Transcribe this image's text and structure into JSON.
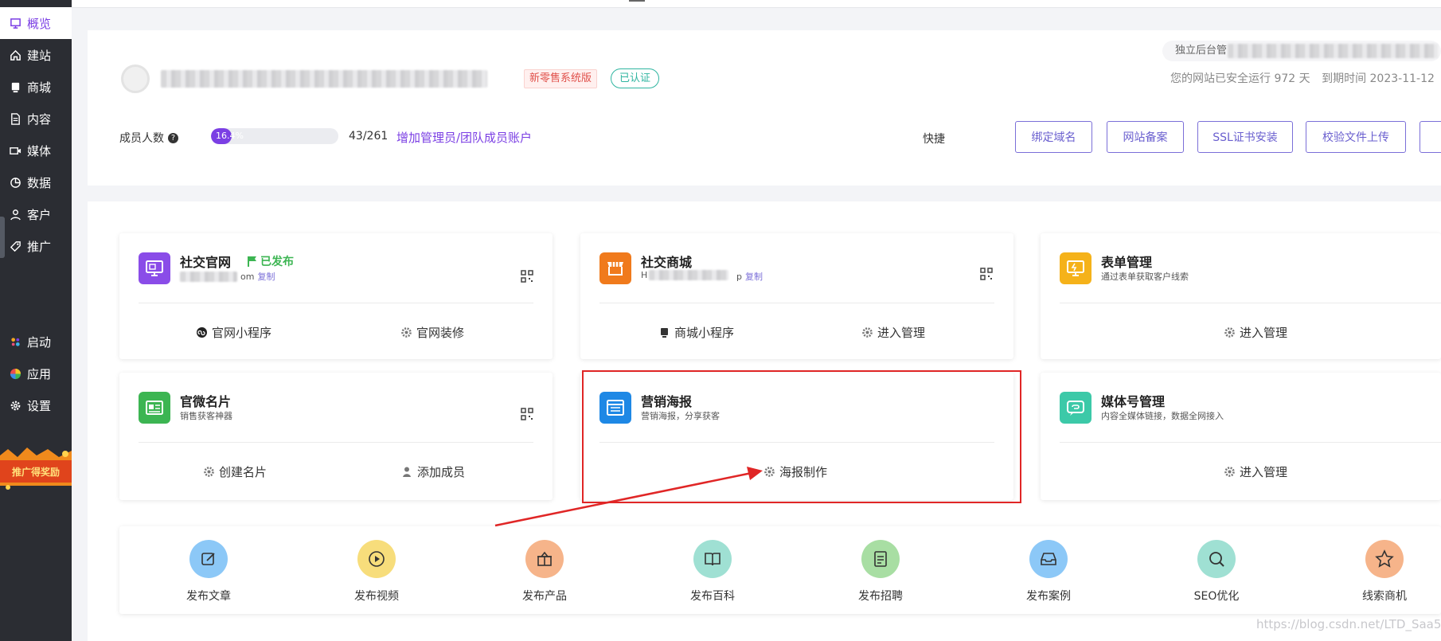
{
  "sidebar": {
    "items": [
      {
        "label": "概览",
        "icon": "overview-icon"
      },
      {
        "label": "建站",
        "icon": "home-icon"
      },
      {
        "label": "商城",
        "icon": "shop-icon"
      },
      {
        "label": "内容",
        "icon": "document-icon"
      },
      {
        "label": "媒体",
        "icon": "video-icon"
      },
      {
        "label": "数据",
        "icon": "pie-chart-icon"
      },
      {
        "label": "客户",
        "icon": "user-icon"
      },
      {
        "label": "推广",
        "icon": "tag-icon"
      },
      {
        "label": "启动",
        "icon": "launch-icon"
      },
      {
        "label": "应用",
        "icon": "apps-icon"
      },
      {
        "label": "设置",
        "icon": "gear-icon"
      }
    ],
    "promo_label": "推广得奖励"
  },
  "header": {
    "plan_tag": "新零售系统版",
    "auth_tag": "已认证",
    "admin_prefix": "独立后台管",
    "run_text": "您的网站已安全运行 972 天",
    "expire_text": "到期时间 2023-11-12",
    "member_label": "成员人数",
    "member_progress": 0.164,
    "member_progress_text": "16.4%",
    "member_count": "43/261",
    "add_admin": "增加管理员/团队成员账户",
    "quick_label": "快捷",
    "quick_buttons": [
      "绑定域名",
      "网站备案",
      "SSL证书安装",
      "校验文件上传"
    ]
  },
  "apps": [
    {
      "title": "社交官网",
      "status": "已发布",
      "sub_tail": "om",
      "copy": "复制",
      "actions": [
        "官网小程序",
        "官网装修"
      ]
    },
    {
      "title": "社交商城",
      "sub_head": "H",
      "sub_tail": "p",
      "copy": "复制",
      "actions": [
        "商城小程序",
        "进入管理"
      ]
    },
    {
      "title": "表单管理",
      "sub": "通过表单获取客户线索",
      "actions": [
        "进入管理"
      ]
    },
    {
      "title": "官微名片",
      "sub": "销售获客神器",
      "actions": [
        "创建名片",
        "添加成员"
      ]
    },
    {
      "title": "营销海报",
      "sub": "营销海报，分享获客",
      "actions": [
        "海报制作"
      ]
    },
    {
      "title": "媒体号管理",
      "sub": "内容全媒体链接，数据全网接入",
      "actions": [
        "进入管理"
      ]
    }
  ],
  "publish": [
    {
      "label": "发布文章",
      "color": "#8cc8f7"
    },
    {
      "label": "发布视频",
      "color": "#f7dd7b"
    },
    {
      "label": "发布产品",
      "color": "#f6b48a"
    },
    {
      "label": "发布百科",
      "color": "#9fe0d3"
    },
    {
      "label": "发布招聘",
      "color": "#a8dea3"
    },
    {
      "label": "发布案例",
      "color": "#8cc8f7"
    },
    {
      "label": "SEO优化",
      "color": "#9fe0d3"
    },
    {
      "label": "线索商机",
      "color": "#f6b48a"
    }
  ],
  "colors": {
    "accent": "#7b3fe4",
    "annotation": "#e02626"
  },
  "watermark": "https://blog.csdn.net/LTD_Saa5"
}
